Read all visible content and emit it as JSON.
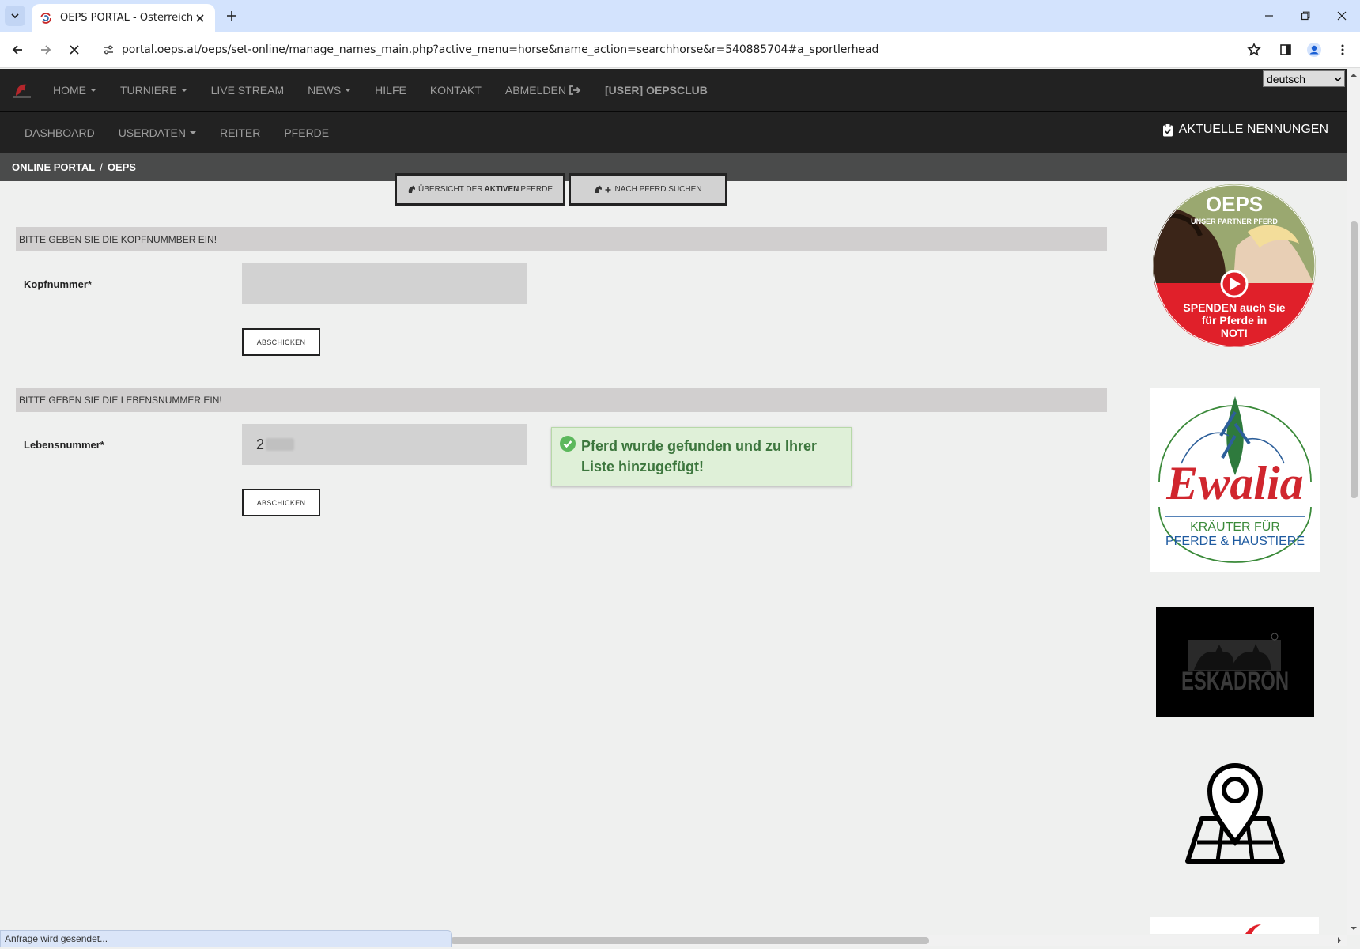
{
  "browser": {
    "tab_title": "OEPS PORTAL - Österreichische",
    "url": "portal.oeps.at/oeps/set-online/manage_names_main.php?active_menu=horse&name_action=searchhorse&r=540885704#a_sportlerhead",
    "status_text": "Anfrage wird gesendet..."
  },
  "topnav": {
    "items": [
      {
        "label": "HOME",
        "dropdown": true
      },
      {
        "label": "TURNIERE",
        "dropdown": true
      },
      {
        "label": "LIVE STREAM"
      },
      {
        "label": "NEWS",
        "dropdown": true
      },
      {
        "label": "HILFE"
      },
      {
        "label": "KONTAKT"
      },
      {
        "label": "ABMELDEN"
      },
      {
        "label": "[USER] OEPSCLUB"
      }
    ],
    "language": "deutsch"
  },
  "subnav": {
    "items": [
      {
        "label": "DASHBOARD"
      },
      {
        "label": "USERDATEN",
        "dropdown": true
      },
      {
        "label": "REITER"
      },
      {
        "label": "PFERDE"
      }
    ],
    "aktuelle_nennungen": "AKTUELLE NENNUNGEN"
  },
  "breadcrumb": {
    "items": [
      "ONLINE PORTAL",
      "OEPS"
    ],
    "separator": "/"
  },
  "horse_tabs": {
    "overview_pre": "ÜBERSICHT DER ",
    "overview_bold": "AKTIVEN",
    "overview_post": " PFERDE",
    "search": "NACH PFERD SUCHEN"
  },
  "form": {
    "section1_title": "BITTE GEBEN SIE DIE KOPFNUMMBER EIN!",
    "kopfnummer_label": "Kopfnummer*",
    "kopfnummer_value": "",
    "submit1": "ABSCHICKEN",
    "section2_title": "BITTE GEBEN SIE DIE LEBENSNUMMER EIN!",
    "lebensnummer_label": "Lebensnummer*",
    "lebensnummer_value": "2",
    "submit2": "ABSCHICKEN"
  },
  "alert": {
    "line1": "Pferd wurde gefunden und zu Ihrer",
    "line2": "Liste hinzugefügt!"
  },
  "ads": {
    "oeps_logo": "OEPS",
    "oeps_tagline": "UNSER PARTNER PFERD",
    "oeps_cta_1": "SPENDEN auch Sie",
    "oeps_cta_2": "für Pferde in",
    "oeps_cta_3": "NOT!",
    "ewalia_name": "Ewalia",
    "ewalia_line1": "KRÄUTER FÜR",
    "ewalia_line2": "PFERDE & HAUSTIERE",
    "eskadron": "ESKADRON"
  },
  "colors": {
    "nav_bg": "#222222",
    "breadcrumb_bg": "#4a4b4b",
    "alert_bg": "#dff0d8",
    "alert_text": "#3c763d",
    "oeps_red": "#e0202a",
    "ewalia_red": "#d0262e",
    "ewalia_green": "#3b8a3a",
    "ewalia_blue": "#1e5aa0"
  }
}
